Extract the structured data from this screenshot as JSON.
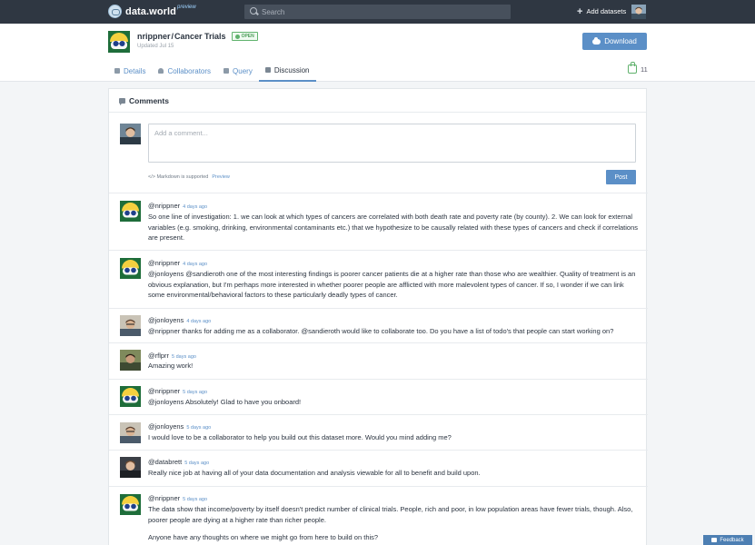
{
  "topbar": {
    "logo_text": "data.world",
    "logo_tag": "preview",
    "search_placeholder": "Search",
    "add_datasets": "Add datasets"
  },
  "dataset": {
    "owner": "nrippner",
    "separator": "/",
    "name": "Cancer Trials",
    "badge": "OPEN",
    "updated": "Updated Jul 15",
    "download": "Download",
    "likes": "11"
  },
  "tabs": [
    {
      "label": "Details"
    },
    {
      "label": "Collaborators"
    },
    {
      "label": "Query"
    },
    {
      "label": "Discussion"
    }
  ],
  "colors": {
    "topbar": "#2f3742",
    "accent": "#5b8fc7",
    "open_green": "#5fb16c"
  },
  "comments_section": {
    "title": "Comments",
    "placeholder": "Add a comment...",
    "markdown_note": "</> Markdown is supported",
    "preview": "Preview",
    "post": "Post"
  },
  "comments": [
    {
      "user": "@nrippner",
      "time": "4 days ago",
      "body": "So one line of investigation: 1. we can look at which types of cancers are correlated with both death rate and poverty rate (by county). 2. We can look for external variables (e.g. smoking, drinking, environmental contaminants etc.) that we hypothesize to be causally related with these types of cancers and check if correlations are present."
    },
    {
      "user": "@nrippner",
      "time": "4 days ago",
      "body": "@jonloyens @sandieroth one of the most interesting findings is poorer cancer patients die at a higher rate than those who are wealthier. Quality of treatment is an obvious explanation, but I'm perhaps more interested in whether poorer people are afflicted with more malevolent types of cancer. If so, I wonder if we can link some environmental/behavioral factors to these particularly deadly types of cancer."
    },
    {
      "user": "@jonloyens",
      "time": "4 days ago",
      "body": "@nrippner thanks for adding me as a collaborator. @sandieroth would like to collaborate too. Do you have a list of todo's that people can start working on?"
    },
    {
      "user": "@rflprr",
      "time": "5 days ago",
      "body": "Amazing work!"
    },
    {
      "user": "@nrippner",
      "time": "5 days ago",
      "body": "@jonloyens Absolutely! Glad to have you onboard!"
    },
    {
      "user": "@jonloyens",
      "time": "5 days ago",
      "body": "I would love to be a collaborator to help you build out this dataset more. Would you mind adding me?"
    },
    {
      "user": "@databrett",
      "time": "5 days ago",
      "body": "Really nice job at having all of your data documentation and analysis viewable for all to benefit and build upon."
    },
    {
      "user": "@nrippner",
      "time": "5 days ago",
      "body": "The data show that income/poverty by itself doesn't predict number of clinical trials. People, rich and poor, in low population areas have fewer trials, though. Also, poorer people are dying at a higher rate than richer people.",
      "body2": "Anyone have any thoughts on where we might go from here to build on this?"
    }
  ],
  "feedback": "Feedback"
}
